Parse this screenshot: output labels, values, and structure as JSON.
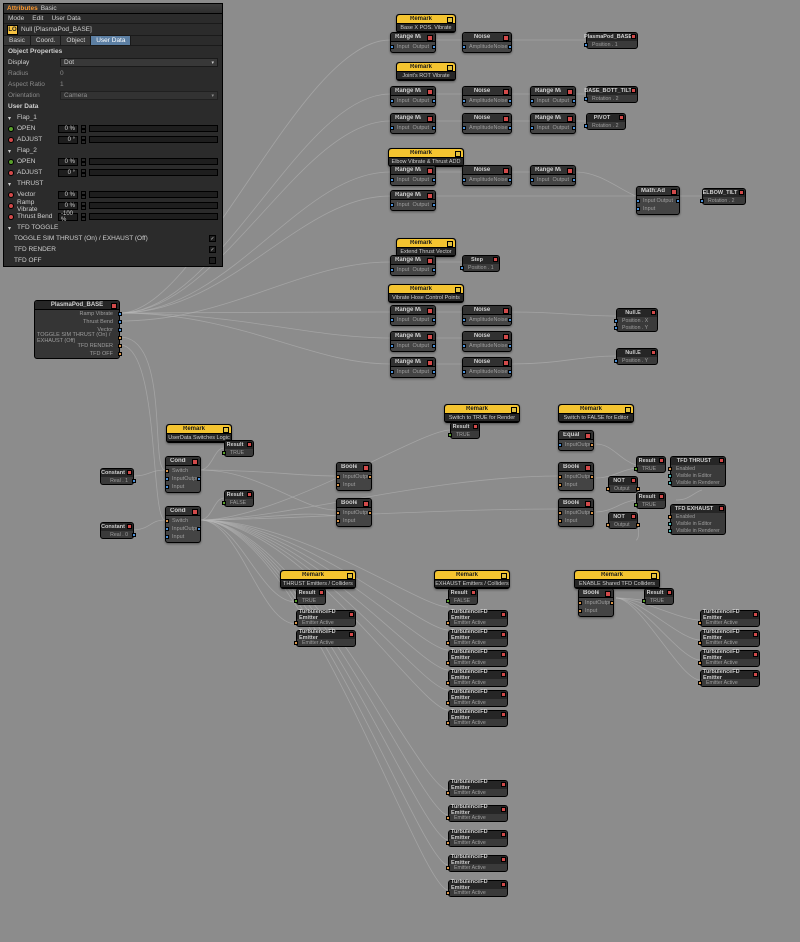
{
  "app": {
    "title_prefix": "Attributes",
    "title_suffix": "Basic"
  },
  "menu": {
    "mode": "Mode",
    "edit": "Edit",
    "userdata": "User Data"
  },
  "obj": {
    "badge": "LO",
    "name": "Null [PlasmaPod_BASE]"
  },
  "tabs": {
    "basic": "Basic",
    "coord": "Coord.",
    "object": "Object",
    "userdata": "User Data"
  },
  "sections": {
    "objprops": "Object Properties",
    "userdata": "User Data"
  },
  "props": {
    "display_lbl": "Display",
    "display_val": "Dot",
    "radius_lbl": "Radius",
    "radius_val": "0",
    "aspect_lbl": "Aspect Ratio",
    "aspect_val": "1",
    "orient_lbl": "Orientation",
    "orient_val": "Camera"
  },
  "groups": {
    "flap1": "Flap_1",
    "flap2": "Flap_2",
    "thrust": "THRUST",
    "tfd": "TFD TOGGLE"
  },
  "sliders": {
    "open": {
      "label": "OPEN",
      "val": "0 %",
      "fill": 0
    },
    "adjust": {
      "label": "ADJUST",
      "val": "0 °",
      "fill": 0
    },
    "open2": {
      "label": "OPEN",
      "val": "0 %",
      "fill": 0
    },
    "adjust2": {
      "label": "ADJUST",
      "val": "0 °",
      "fill": 0
    },
    "vector": {
      "label": "Vector",
      "val": "0 %",
      "fill": 0
    },
    "ramp": {
      "label": "Ramp Vibrate",
      "val": "0 %",
      "fill": 0
    },
    "thrustbend": {
      "label": "Thrust Bend",
      "val": "-100 %",
      "fill": 0
    }
  },
  "checks": {
    "toggle": {
      "label": "TOGGLE  SIM THRUST (On) / EXHAUST (Off)",
      "checked": true
    },
    "render": {
      "label": "TFD RENDER",
      "checked": true
    },
    "tfdoff": {
      "label": "TFD OFF",
      "checked": false
    }
  },
  "src": {
    "title": "PlasmaPod_BASE",
    "p0": "Ramp Vibrate",
    "p1": "Thrust Bend",
    "p2": "Vector",
    "p3": "TOGGLE  SIM THRUST (On) / EXHAUST (Off)",
    "p4": "TFD RENDER",
    "p5": "TFD OFF"
  },
  "rem": {
    "r0": "Base X POS. Vibrate",
    "r1": "Joint's ROT Vibrate",
    "r2": "Elbow Vibrate & Thrust ADD",
    "r3": "Extend Thrust Vector",
    "r4": "Vibrate Hose Control Points",
    "r5": "UserData Switches Logic",
    "r6": "Switch to TRUE for Render",
    "r7": "Switch to FALSE for Editor",
    "r8": "THRUST Emitters / Colliders",
    "r9": "EXHAUST Emitters / Colliders",
    "r10": "ENABLE Shared TFD Colliders"
  },
  "nodes": {
    "remark": "Remark",
    "rangeMapper": "Range Mapper",
    "noise": "Noise",
    "mathAdd": "Math:Add",
    "condition": "Condition",
    "result": "Result",
    "constant": "Constant",
    "boole": "Boole",
    "equal": "Equal",
    "not": "NOT",
    "step": "Step",
    "tfdEmitter": "TurbulenceFD Emitter"
  },
  "labels": {
    "input": "Input",
    "output": "Output",
    "amplitude": "Amplitude",
    "noise": "Noise",
    "switch": "Switch",
    "real1": "Real . 1",
    "real0": "Real . 0",
    "true": "TRUE",
    "false": "FALSE",
    "position": "Position . 1",
    "rotation": "Rotation . 2",
    "posx": "Position . X",
    "posy": "Position . Y",
    "emitterActive": "Emitter Active",
    "enabled": "Enabled",
    "visEditor": "Visible in Editor",
    "visRender": "Visible in Renderer"
  },
  "links": {
    "plasmaBase": "PlasmaPod_BASE",
    "baseBott": "BASE_BOTT_TILT",
    "pivot": "PIVOT",
    "elbowTilt": "ELBOW_TILT",
    "nullE": "Null.E",
    "tfdThrust": "TFD THRUST",
    "tfdExhaust": "TFD EXHAUST"
  }
}
